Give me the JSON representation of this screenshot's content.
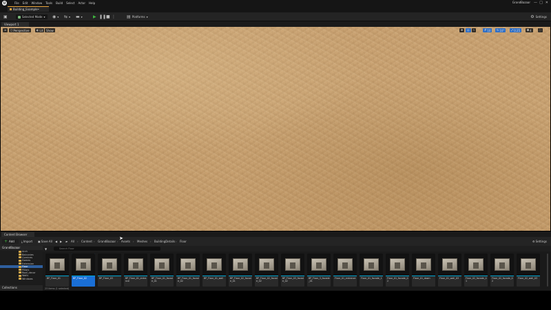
{
  "app": {
    "menu": [
      "File",
      "Edit",
      "Window",
      "Tools",
      "Build",
      "Select",
      "Actor",
      "Help"
    ],
    "project_name": "GrandBazaar",
    "window_buttons": [
      "—",
      "□",
      "✕"
    ]
  },
  "tab": {
    "level_name": "Building_Example•"
  },
  "toolbar": {
    "save_glyph": "💾",
    "mode_label": "Selected Mode",
    "platforms_label": "Platforms",
    "settings_label": "Settings"
  },
  "viewport": {
    "tab_label": "Viewport 1",
    "perspective_label": "Perspective",
    "lit_label": "Lit",
    "show_label": "Show",
    "snap_values": [
      "10",
      "10°",
      "0.25",
      "4"
    ]
  },
  "content_browser": {
    "tab_label": "Content Browser",
    "add_label": "Add",
    "import_label": "Import",
    "save_all_label": "Save All",
    "settings_label": "Settings",
    "breadcrumbs": [
      "All",
      "Content",
      "GrandBazaar",
      "Assets",
      "Meshes",
      "BuildingDetails",
      "Floor"
    ],
    "search_placeholder": "Search Floor",
    "tree_root": "GrandBazaar",
    "tree_items": [
      "Arch",
      "Balconies",
      "Cornices",
      "Domes",
      "Extension",
      "Floor",
      "Pillars",
      "Roof_decor",
      "Walls",
      "Windows"
    ],
    "tree_selected": "Floor",
    "collections_label": "Collections",
    "status_text": "23 items (1 selected)",
    "assets": [
      {
        "label": "BP_Floor_01",
        "selected": false
      },
      {
        "label": "BP_Floor_02",
        "selected": true
      },
      {
        "label": "BP_Floor_03",
        "selected": false
      },
      {
        "label": "BP_Floor_01_entrance",
        "selected": false
      },
      {
        "label": "BP_Floor_01_facade_01",
        "selected": false
      },
      {
        "label": "BP_Floor_01_facade_02",
        "selected": false
      },
      {
        "label": "BP_Floor_01_wall",
        "selected": false
      },
      {
        "label": "BP_Floor_02_facade_01",
        "selected": false
      },
      {
        "label": "BP_Floor_02_facade_02",
        "selected": false
      },
      {
        "label": "BP_Floor_03_facade_02",
        "selected": false
      },
      {
        "label": "BP_Floor_3_facade_01",
        "selected": false
      },
      {
        "label": "Floor_01_entrance",
        "selected": false
      },
      {
        "label": "Floor_01_facade_1",
        "selected": false
      },
      {
        "label": "Floor_01_facade_02",
        "selected": false
      },
      {
        "label": "Floor_01_down",
        "selected": false
      },
      {
        "label": "Floor_01_wall_03",
        "selected": false
      },
      {
        "label": "Floor_02_facade_01",
        "selected": false
      },
      {
        "label": "Floor_02_facade_02",
        "selected": false
      },
      {
        "label": "Floor_02_wall_03",
        "selected": false
      }
    ]
  },
  "colors": {
    "accent": "#e8a33b",
    "selection": "#1a6fd6",
    "play": "#3fb83f",
    "asset_strip": "#00a7d4",
    "sand": "#c9a272"
  }
}
